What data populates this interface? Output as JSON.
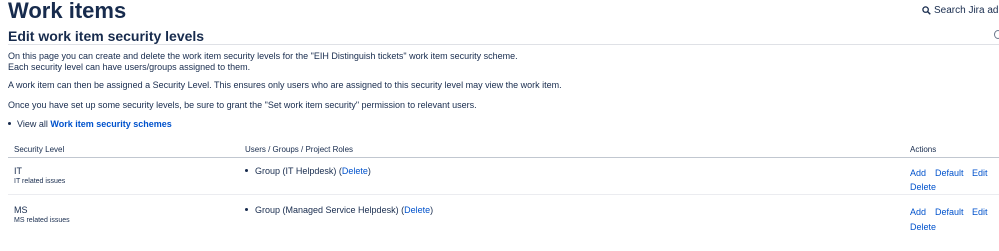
{
  "header": {
    "title": "Work items",
    "search_label": "Search Jira admin"
  },
  "section": {
    "title": "Edit work item security levels",
    "intro_line1": "On this page you can create and delete the work item security levels for the \"EIH Distinguish tickets\" work item security scheme.",
    "intro_line2": "Each security level can have users/groups assigned to them.",
    "intro_para2": "A work item can then be assigned a Security Level. This ensures only users who are assigned to this security level may view the work item.",
    "intro_para3": "Once you have set up some security levels, be sure to grant the \"Set work item security\" permission to relevant users.",
    "view_all_prefix": "View all",
    "view_all_link": "Work item security schemes"
  },
  "table": {
    "headers": [
      "Security Level",
      "Users / Groups / Project Roles",
      "Actions"
    ],
    "rows": [
      {
        "name": "IT",
        "description": "IT related issues",
        "member": "Group (IT Helpdesk)",
        "delete_member": "Delete",
        "open_paren": "(",
        "close_paren": ")",
        "actions": {
          "add": "Add",
          "default": "Default",
          "edit": "Edit",
          "delete": "Delete"
        }
      },
      {
        "name": "MS",
        "description": "MS related issues",
        "member": "Group (Managed Service Helpdesk)",
        "delete_member": "Delete",
        "open_paren": "(",
        "close_paren": ")",
        "actions": {
          "add": "Add",
          "default": "Default",
          "edit": "Edit",
          "delete": "Delete"
        }
      }
    ]
  }
}
